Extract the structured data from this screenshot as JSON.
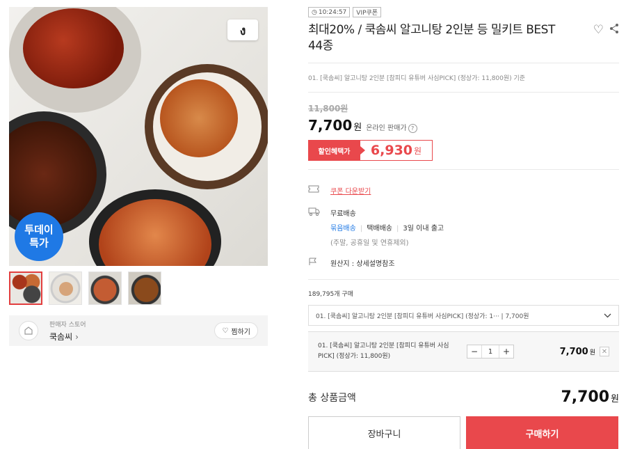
{
  "hero": {
    "brand_badge": "ง",
    "today_badge_line1": "투데이",
    "today_badge_line2": "특가"
  },
  "seller": {
    "sub_label": "판매자 스토어",
    "name": "쿡솜씨",
    "favorite_label": "찜하기"
  },
  "tags": {
    "timer": "10:24:57",
    "vip": "VIP쿠폰"
  },
  "product": {
    "title": "최대20% / 쿡솜씨 알고니탕 2인분 등 밀키트 BEST 44종",
    "option_reference": "01. [쿡솜씨] 알고니탕 2인분 [참피디 유튜버 사심PICK] (정상가: 11,800원) 기준",
    "original_price": "11,800원",
    "price": "7,700",
    "currency": "원",
    "price_sub": "온라인 판매가",
    "discount_label": "할인혜택가",
    "discount_price": "6,930",
    "coupon_link": "쿠폰 다운받기",
    "shipping_free": "무료배송",
    "shipping_bundle": "묶음배송",
    "shipping_method": "택배배송",
    "shipping_time": "3일 이내 출고",
    "shipping_note": "(주말, 공휴일 및 연휴제외)",
    "origin": "원산지 : 상세설명참조",
    "buy_count": "189,795개 구매"
  },
  "option": {
    "select_value": "01. [쿡솜씨] 알고니탕 2인분 [참피디 유튜버 사심PICK] (정상가: 1···  |  7,700원",
    "selected_name": "01. [쿡솜씨] 알고니탕 2인분 [참피디 유튜버 사심PICK] (정상가: 11,800원)",
    "quantity": "1",
    "selected_price": "7,700"
  },
  "total": {
    "label": "총 상품금액",
    "price": "7,700"
  },
  "buttons": {
    "cart": "장바구니",
    "buy": "구매하기"
  },
  "colors": {
    "accent": "#e9484c",
    "blue": "#1f79e5"
  }
}
